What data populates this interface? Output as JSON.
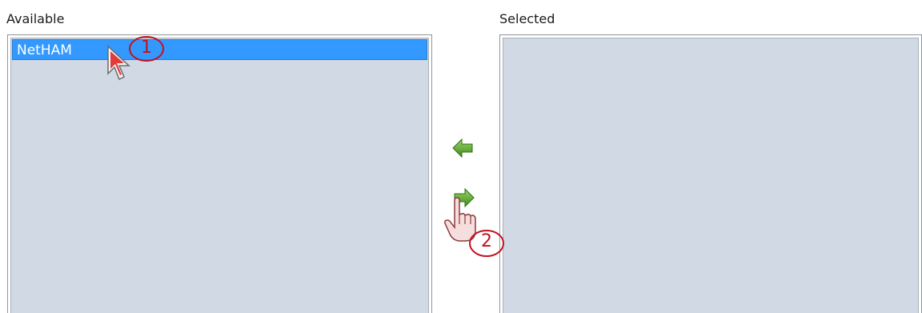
{
  "available": {
    "label": "Available",
    "items": [
      {
        "label": "NetHAM",
        "selected": true
      }
    ]
  },
  "selected": {
    "label": "Selected",
    "items": []
  },
  "buttons": {
    "move_left": {
      "icon": "arrow-left-icon",
      "color": "#5fa32e"
    },
    "move_right": {
      "icon": "arrow-right-icon",
      "color": "#5fa32e"
    }
  },
  "annotations": {
    "step1": "1",
    "step2": "2",
    "color": "#c1121f"
  },
  "colors": {
    "list_background": "#d0d9e4",
    "selection": "#3399ff"
  }
}
